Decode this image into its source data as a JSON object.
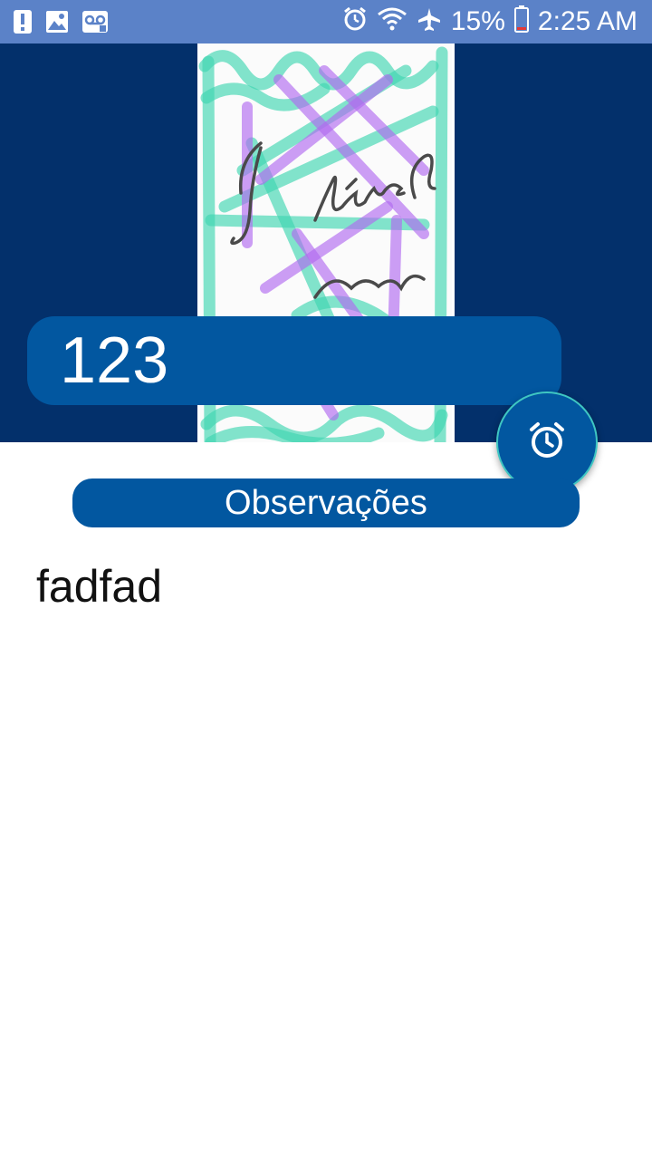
{
  "status_bar": {
    "battery_percent": "15%",
    "time": "2:25 AM",
    "left_icons": [
      "alert-icon",
      "image-icon",
      "voicemail-icon"
    ],
    "right_icons": [
      "alarm-icon",
      "wifi-icon",
      "airplane-icon",
      "battery-icon"
    ]
  },
  "header": {
    "background_color": "#03306b",
    "title": "123"
  },
  "fab": {
    "icon": "alarm-clock-icon"
  },
  "observations": {
    "label": "Observações",
    "text": "fadfad"
  },
  "colors": {
    "accent": "#0257a0",
    "status_bar": "#5b82c8",
    "fab_border": "#3fc6c2"
  }
}
